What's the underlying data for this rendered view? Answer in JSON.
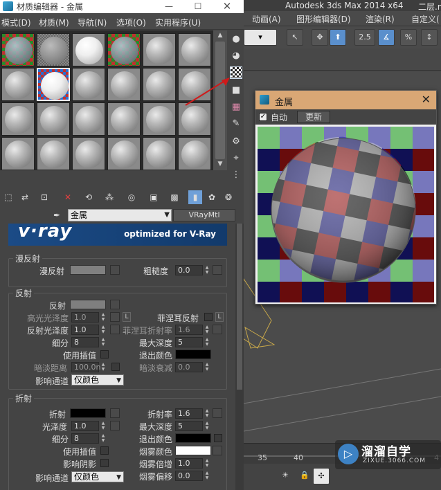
{
  "app": {
    "title": "Autodesk 3ds Max  2014 x64",
    "title_tail": "二层.m",
    "menu": [
      "动画(A)",
      "图形编辑器(D)",
      "渲染(R)",
      "自定义("
    ],
    "toolbar_value": "2.5",
    "timeline_ticks": [
      "35",
      "40",
      "4"
    ]
  },
  "material_editor": {
    "title": "材质编辑器 - 金属",
    "close_glyph": "✕",
    "menu": [
      "模式(D)",
      "材质(M)",
      "导航(N)",
      "选项(O)",
      "实用程序(U)"
    ],
    "material_name": "金属",
    "material_type": "VRayMtl",
    "slot_count": 24,
    "banner": {
      "logo": "v·ray",
      "slogan": "optimized for V-Ray"
    },
    "diffuse": {
      "section": "漫反射",
      "diffuse_label": "漫反射",
      "roughness_label": "粗糙度",
      "roughness_value": "0.0"
    },
    "reflection": {
      "section": "反射",
      "reflect_label": "反射",
      "hilight_gloss_label": "高光光泽度",
      "hilight_gloss_value": "1.0",
      "lock_label": "L",
      "fresnel_label": "菲涅耳反射",
      "refl_gloss_label": "反射光泽度",
      "refl_gloss_value": "1.0",
      "fresnel_ior_label": "菲涅耳折射率",
      "fresnel_ior_value": "1.6",
      "subdivs_label": "细分",
      "subdivs_value": "8",
      "max_depth_label": "最大深度",
      "max_depth_value": "5",
      "use_interp_label": "使用插值",
      "exit_color_label": "退出颜色",
      "dim_distance_label": "暗淡距离",
      "dim_distance_value": "100.0n",
      "dim_falloff_label": "暗淡衰减",
      "dim_falloff_value": "0.0",
      "affect_channels_label": "影响通道",
      "affect_channels_value": "仅颜色"
    },
    "refraction": {
      "section": "折射",
      "refract_label": "折射",
      "ior_label": "折射率",
      "ior_value": "1.6",
      "gloss_label": "光泽度",
      "gloss_value": "1.0",
      "max_depth_label": "最大深度",
      "max_depth_value": "5",
      "subdivs_label": "细分",
      "subdivs_value": "8",
      "exit_color_label": "退出颜色",
      "use_interp_label": "使用插值",
      "fog_color_label": "烟雾颜色",
      "affect_shadows_label": "影响阴影",
      "fog_mult_label": "烟雾倍增",
      "fog_mult_value": "1.0",
      "affect_channels_label": "影响通道",
      "affect_channels_value": "仅颜色",
      "fog_bias_label": "烟雾偏移",
      "fog_bias_value": "0.0"
    }
  },
  "preview": {
    "title": "金属",
    "close_glyph": "✕",
    "auto_label": "自动",
    "update_label": "更新"
  },
  "watermark": {
    "logo_glyph": "▷",
    "title": "溜溜自学",
    "url": "ZIXUE.3066.COM"
  }
}
